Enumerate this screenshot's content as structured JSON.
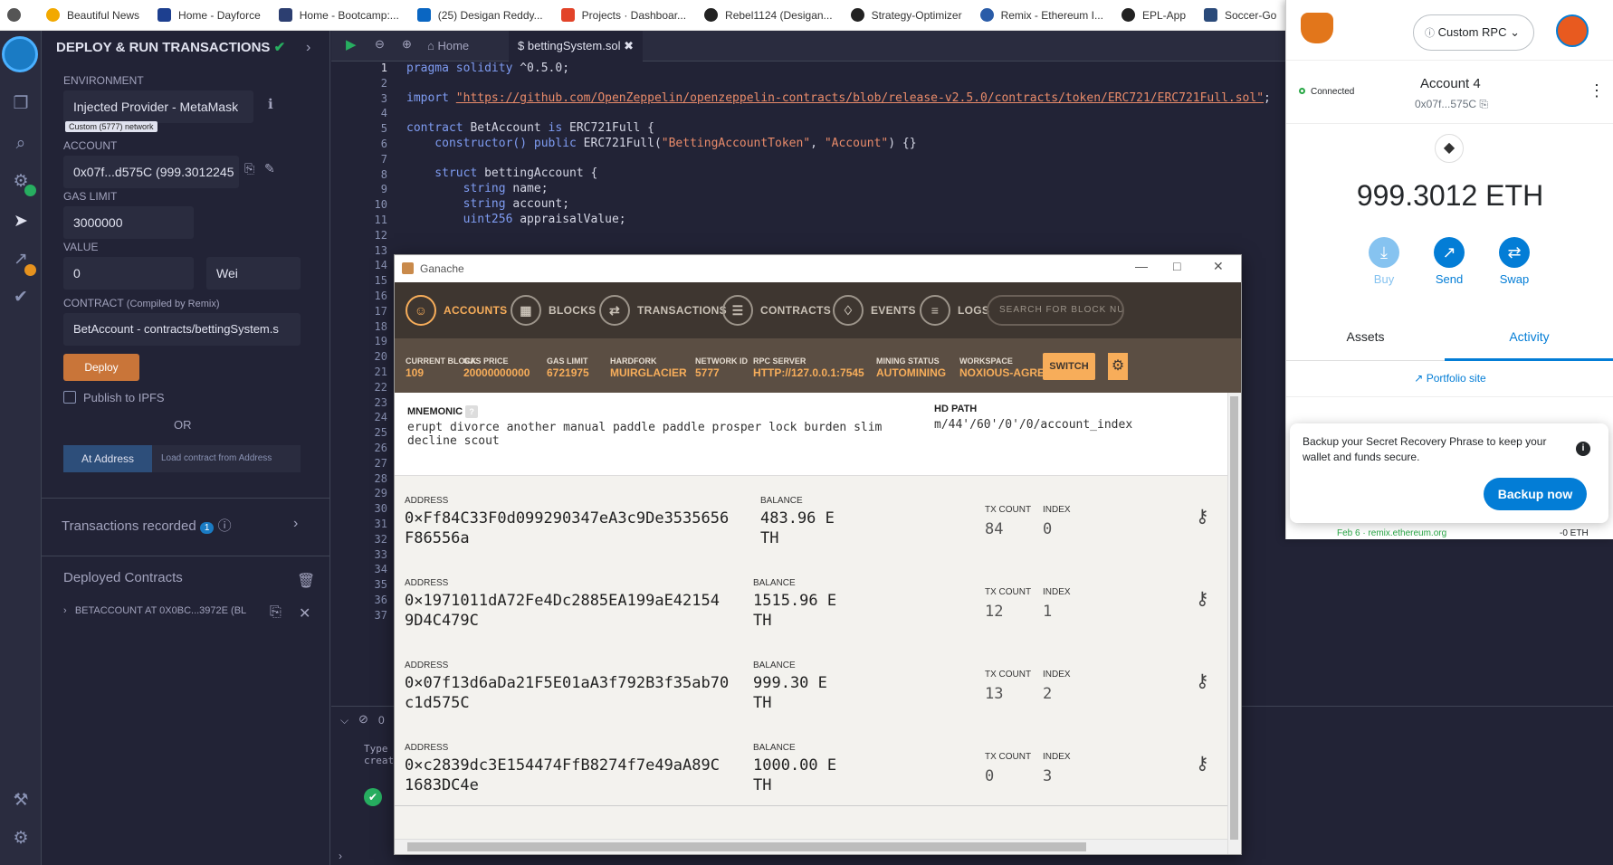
{
  "bookmarks": [
    {
      "label": "",
      "color": "#444"
    },
    {
      "label": "Beautiful News",
      "color": "#f2a900"
    },
    {
      "label": "Home - Dayforce",
      "color": "#1d3f8f"
    },
    {
      "label": "Home - Bootcamp:...",
      "color": "#2c3e70"
    },
    {
      "label": "(25) Desigan Reddy...",
      "color": "#0a66c2"
    },
    {
      "label": "Projects · Dashboar...",
      "color": "#e24329"
    },
    {
      "label": "Rebel1124 (Desigan...",
      "color": "#222"
    },
    {
      "label": "Strategy-Optimizer",
      "color": "#222"
    },
    {
      "label": "Remix - Ethereum I...",
      "color": "#2a5ca8"
    },
    {
      "label": "EPL-App",
      "color": "#222"
    },
    {
      "label": "Soccer-Go",
      "color": "#2a4a7a"
    }
  ],
  "sidepanel": {
    "title": "DEPLOY & RUN TRANSACTIONS",
    "environment_label": "ENVIRONMENT",
    "environment_value": "Injected Provider - MetaMask",
    "network_badge": "Custom (5777) network",
    "account_label": "ACCOUNT",
    "account_value": "0x07f...d575C (999.3012245",
    "gas_limit_label": "GAS LIMIT",
    "gas_limit_value": "3000000",
    "value_label": "VALUE",
    "value_value": "0",
    "value_unit": "Wei",
    "contract_label": "CONTRACT",
    "contract_sub": "(Compiled by Remix)",
    "contract_value": "BetAccount - contracts/bettingSystem.s",
    "deploy_label": "Deploy",
    "publish_label": "Publish to IPFS",
    "or_label": "OR",
    "at_address_label": "At Address",
    "load_placeholder": "Load contract from Address",
    "transactions_label": "Transactions recorded",
    "transactions_count": "1",
    "deployed_label": "Deployed Contracts",
    "deployed_item": "BETACCOUNT AT 0X0BC...3972E (BL"
  },
  "editor": {
    "home_tab": "Home",
    "file_tab": "bettingSystem.sol",
    "line_numbers": [
      "1",
      "2",
      "3",
      "4",
      "5",
      "6",
      "7",
      "8",
      "9",
      "10",
      "11",
      "12",
      "13",
      "14",
      "15",
      "16",
      "17",
      "18",
      "19",
      "20",
      "21",
      "22",
      "23",
      "24",
      "25",
      "26",
      "27",
      "28",
      "29",
      "30",
      "31",
      "32",
      "33",
      "34",
      "35",
      "36",
      "37"
    ],
    "code": {
      "l1a": "pragma solidity",
      "l1b": " ^0.5.0;",
      "l3a": "import ",
      "l3b": "\"https://github.com/OpenZeppelin/openzeppelin-contracts/blob/release-v2.5.0/contracts/token/ERC721/ERC721Full.sol\"",
      "l3c": ";",
      "l5a": "contract",
      "l5b": " BetAccount ",
      "l5c": "is",
      "l5d": " ERC721Full {",
      "l6a": "    constructor() ",
      "l6b": "public",
      "l6c": " ERC721Full(",
      "l6d": "\"BettingAccountToken\"",
      "l6e": ", ",
      "l6f": "\"Account\"",
      "l6g": ") {}",
      "l8a": "    struct",
      "l8b": " bettingAccount {",
      "l9a": "        string",
      "l9b": " name;",
      "l10a": "        string",
      "l10b": " account;",
      "l11a": "        uint256",
      "l11b": " appraisalValue;"
    },
    "terminal_text_1": "Type",
    "terminal_text_2": "creat",
    "terminal_count": "0"
  },
  "ganache": {
    "title": "Ganache",
    "nav": [
      "ACCOUNTS",
      "BLOCKS",
      "TRANSACTIONS",
      "CONTRACTS",
      "EVENTS",
      "LOGS"
    ],
    "search_placeholder": "SEARCH FOR BLOCK NUMBERS OR TX HASHES",
    "stats": [
      {
        "label": "CURRENT BLOCK",
        "value": "109"
      },
      {
        "label": "GAS PRICE",
        "value": "20000000000"
      },
      {
        "label": "GAS LIMIT",
        "value": "6721975"
      },
      {
        "label": "HARDFORK",
        "value": "MUIRGLACIER"
      },
      {
        "label": "NETWORK ID",
        "value": "5777"
      },
      {
        "label": "RPC SERVER",
        "value": "HTTP://127.0.0.1:7545"
      },
      {
        "label": "MINING STATUS",
        "value": "AUTOMINING"
      },
      {
        "label": "WORKSPACE",
        "value": "NOXIOUS-AGREEMENT"
      }
    ],
    "switch_label": "SWITCH",
    "mnemonic_label": "MNEMONIC",
    "mnemonic_line1": "erupt divorce another manual paddle paddle prosper lock burden slim",
    "mnemonic_line2": "decline scout",
    "hd_path_label": "HD PATH",
    "hd_path_value": "m/44'/60'/0'/0/account_index",
    "address_label": "ADDRESS",
    "balance_label": "BALANCE",
    "txcount_label": "TX COUNT",
    "index_label": "INDEX",
    "accounts": [
      {
        "addr1": "0×Ff84C33F0d099290347eA3c9De3535656",
        "addr2": "F86556a",
        "bal1": "483.96 E",
        "bal2": "TH",
        "tx": "84",
        "index": "0"
      },
      {
        "addr1": "0×1971011dA72Fe4Dc2885EA199aE42154",
        "addr2": "9D4C479C",
        "bal1": "1515.96 E",
        "bal2": "TH",
        "tx": "12",
        "index": "1"
      },
      {
        "addr1": "0×07f13d6aDa21F5E01aA3f792B3f35ab70",
        "addr2": "c1d575C",
        "bal1": "999.30 E",
        "bal2": "TH",
        "tx": "13",
        "index": "2"
      },
      {
        "addr1": "0×c2839dc3E154474FfB8274f7e49aA89C",
        "addr2": "1683DC4e",
        "bal1": "1000.00 E",
        "bal2": "TH",
        "tx": "0",
        "index": "3"
      }
    ]
  },
  "metamask": {
    "network": "Custom RPC",
    "connected": "Connected",
    "account_name": "Account 4",
    "account_address": "0x07f...575C",
    "balance": "999.3012 ETH",
    "actions": [
      "Buy",
      "Send",
      "Swap"
    ],
    "tabs": [
      "Assets",
      "Activity"
    ],
    "portfolio_link": "Portfolio site",
    "backup_text": "Backup your Secret Recovery Phrase to keep your wallet and funds secure.",
    "backup_button": "Backup now",
    "activity_date": "Feb 6 · remix.ethereum.org",
    "activity_amount": "-0 ETH",
    "accent": "#037dd6"
  }
}
